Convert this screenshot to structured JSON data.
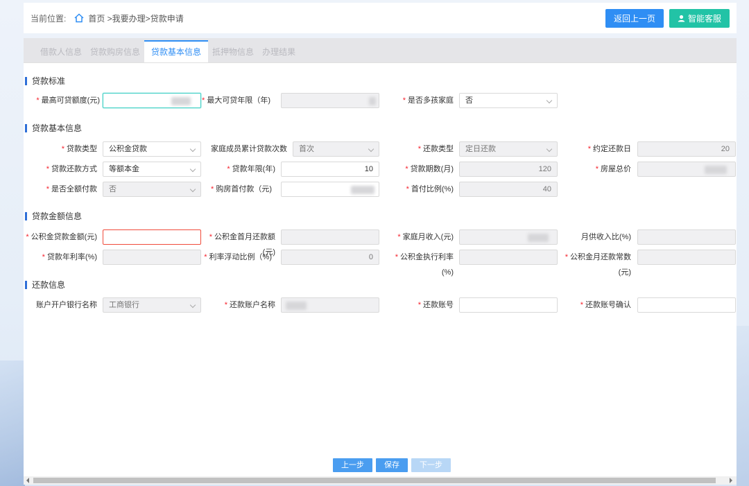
{
  "header": {
    "location_label": "当前位置:",
    "breadcrumb": "首页 >我要办理>贷款申请",
    "back_button": "返回上一页",
    "service_button": "智能客服"
  },
  "tabs": [
    "借款人信息",
    "贷款购房信息",
    "贷款基本信息",
    "抵押物信息",
    "办理结果"
  ],
  "active_tab": "贷款基本信息",
  "sections": {
    "standard": "贷款标准",
    "basic": "贷款基本信息",
    "amount": "贷款金额信息",
    "repay": "还款信息"
  },
  "standard": {
    "max_amount_label": "最高可贷额度(元)",
    "max_years_label": "最大可贷年限（年)",
    "multi_child_label": "是否多孩家庭",
    "multi_child_value": "否"
  },
  "basic": {
    "loan_type_label": "贷款类型",
    "loan_type_value": "公积金贷款",
    "family_count_label": "家庭成员累计贷款次数",
    "family_count_value": "首次",
    "repay_type_label": "还款类型",
    "repay_type_value": "定日还款",
    "due_day_label": "约定还款日",
    "due_day_value": "20",
    "repay_method_label": "贷款还款方式",
    "repay_method_value": "等额本金",
    "loan_years_label": "贷款年限(年)",
    "loan_years_value": "10",
    "loan_months_label": "贷款期数(月)",
    "loan_months_value": "120",
    "house_total_label": "房屋总价",
    "full_pay_label": "是否全额付款",
    "full_pay_value": "否",
    "down_payment_label": "购房首付款（元)",
    "down_ratio_label": "首付比例(%)",
    "down_ratio_value": "40"
  },
  "amount": {
    "fund_loan_label": "公积金贷款金额(元)",
    "first_month_label": "公积金首月还款额(元)",
    "family_income_label": "家庭月收入(元)",
    "monthly_ratio_label": "月供收入比(%)",
    "annual_rate_label": "贷款年利率(%)",
    "float_ratio_label": "利率浮动比例（%)",
    "float_ratio_value": "0",
    "exec_rate_label": "公积金执行利率(%)",
    "monthly_const_label": "公积金月还款常数(元)"
  },
  "repay": {
    "bank_label": "账户开户银行名称",
    "bank_value": "工商银行",
    "account_name_label": "还款账户名称",
    "account_no_label": "还款账号",
    "account_confirm_label": "还款账号确认"
  },
  "footer": {
    "prev": "上一步",
    "save": "保存",
    "next": "下一步"
  },
  "colors": {
    "primary": "#2f8ef4",
    "service": "#22c3a6",
    "required": "#f5222d",
    "section_bar": "#2f6fd8"
  }
}
